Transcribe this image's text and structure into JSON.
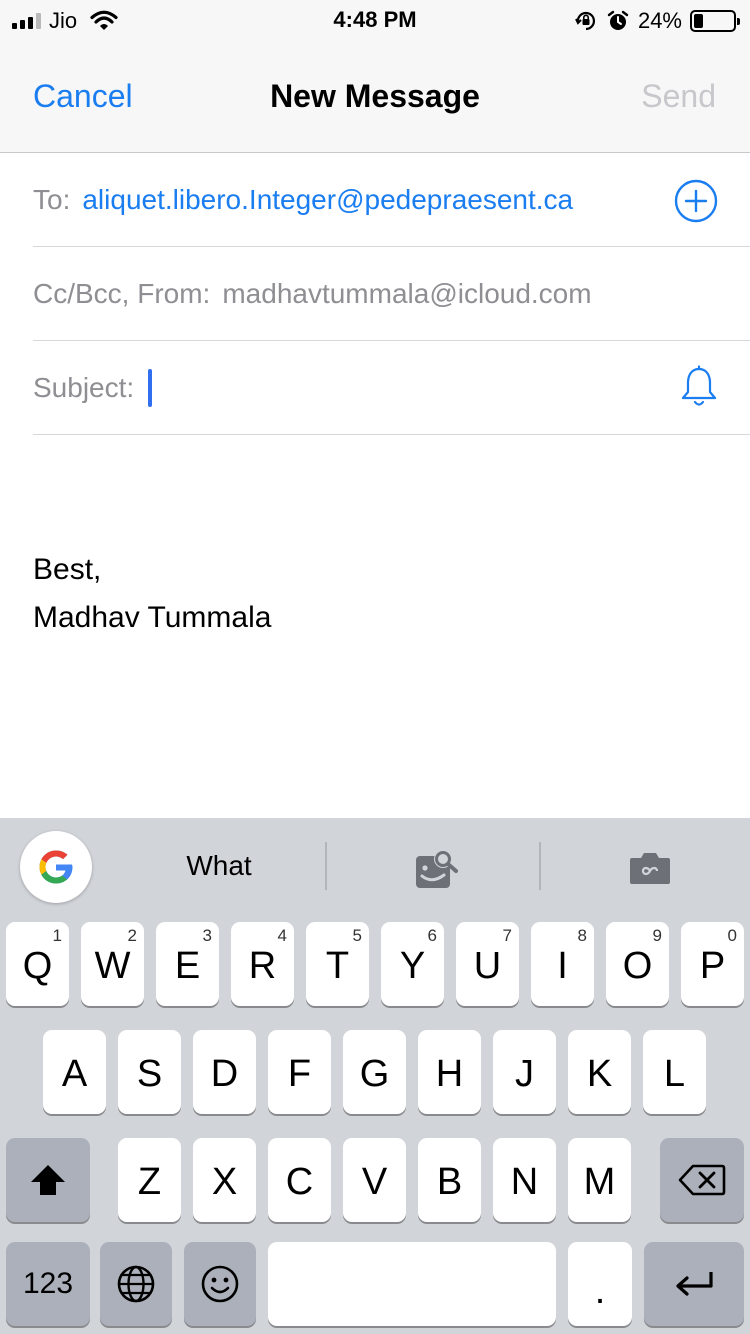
{
  "status_bar": {
    "carrier": "Jio",
    "time": "4:48 PM",
    "battery_percent": "24%",
    "battery_level": 0.24,
    "icons": [
      "signal-icon",
      "wifi-icon",
      "orientation-lock-icon",
      "alarm-icon",
      "battery-icon"
    ]
  },
  "nav": {
    "cancel_label": "Cancel",
    "title": "New Message",
    "send_label": "Send"
  },
  "fields": {
    "to_label": "To:",
    "to_value": "aliquet.libero.Integer@pedepraesent.ca",
    "cc_label": "Cc/Bcc, From:",
    "cc_value": "madhavtummala@icloud.com",
    "subject_label": "Subject:",
    "subject_value": ""
  },
  "body": {
    "line1": "Best,",
    "line2": "Madhav Tummala"
  },
  "keyboard": {
    "suggestion": "What",
    "row1": [
      {
        "key": "Q",
        "num": "1"
      },
      {
        "key": "W",
        "num": "2"
      },
      {
        "key": "E",
        "num": "3"
      },
      {
        "key": "R",
        "num": "4"
      },
      {
        "key": "T",
        "num": "5"
      },
      {
        "key": "Y",
        "num": "6"
      },
      {
        "key": "U",
        "num": "7"
      },
      {
        "key": "I",
        "num": "8"
      },
      {
        "key": "O",
        "num": "9"
      },
      {
        "key": "P",
        "num": "0"
      }
    ],
    "row2": [
      "A",
      "S",
      "D",
      "F",
      "G",
      "H",
      "J",
      "K",
      "L"
    ],
    "row3": [
      "Z",
      "X",
      "C",
      "V",
      "B",
      "N",
      "M"
    ],
    "numbers_label": "123",
    "period_label": ".",
    "accent_color": "#1a7df0"
  }
}
